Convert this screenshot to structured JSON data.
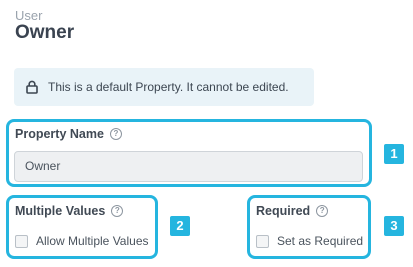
{
  "header": {
    "subtitle": "User",
    "title": "Owner"
  },
  "notice": {
    "icon": "lock-icon",
    "text": "This is a default Property. It cannot be edited."
  },
  "fields": {
    "property_name": {
      "label": "Property Name",
      "value": "Owner"
    },
    "multiple_values": {
      "label": "Multiple Values",
      "checkbox_label": "Allow Multiple Values",
      "checked": false
    },
    "required": {
      "label": "Required",
      "checkbox_label": "Set as Required",
      "checked": false
    }
  },
  "help_glyph": "?",
  "callouts": [
    "1",
    "2",
    "3"
  ],
  "colors": {
    "highlight": "#25b5df",
    "notice_bg": "#e9f3f8"
  }
}
